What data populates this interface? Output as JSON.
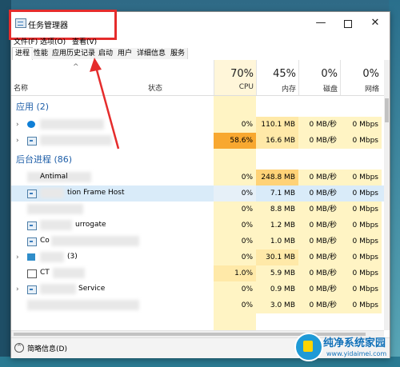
{
  "window": {
    "title": "任务管理器"
  },
  "menu": {
    "file": "文件(F)",
    "options": "选项(O)",
    "view": "查看(V)"
  },
  "tabs": [
    "进程",
    "性能",
    "应用历史记录",
    "启动",
    "用户",
    "详细信息",
    "服务"
  ],
  "header": {
    "name": "名称",
    "status": "状态",
    "cpu": {
      "pct": "70%",
      "label": "CPU"
    },
    "memory": {
      "pct": "45%",
      "label": "内存"
    },
    "disk": {
      "pct": "0%",
      "label": "磁盘"
    },
    "network": {
      "pct": "0%",
      "label": "网络"
    }
  },
  "groups": {
    "apps": "应用 (2)",
    "background": "后台进程 (86)"
  },
  "rows": [
    {
      "name": "",
      "cpu": "0%",
      "mem": "110.1 MB",
      "disk": "0 MB/秒",
      "net": "0 Mbps",
      "icon": "edge-icon"
    },
    {
      "name": "",
      "cpu": "58.6%",
      "mem": "16.6 MB",
      "disk": "0 MB/秒",
      "net": "0 Mbps",
      "icon": "task-manager-icon"
    },
    {
      "name": "Antimal",
      "cpu": "0%",
      "mem": "248.8 MB",
      "disk": "0 MB/秒",
      "net": "0 Mbps",
      "icon": ""
    },
    {
      "name": "tion Frame Host",
      "cpu": "0%",
      "mem": "7.1 MB",
      "disk": "0 MB/秒",
      "net": "0 Mbps",
      "icon": "app-icon"
    },
    {
      "name": "",
      "cpu": "0%",
      "mem": "8.8 MB",
      "disk": "0 MB/秒",
      "net": "0 Mbps",
      "icon": ""
    },
    {
      "name": "urrogate",
      "cpu": "0%",
      "mem": "1.2 MB",
      "disk": "0 MB/秒",
      "net": "0 Mbps",
      "icon": "app-icon"
    },
    {
      "name": "Co",
      "cpu": "0%",
      "mem": "1.0 MB",
      "disk": "0 MB/秒",
      "net": "0 Mbps",
      "icon": "app-icon"
    },
    {
      "name": "(3)",
      "cpu": "0%",
      "mem": "30.1 MB",
      "disk": "0 MB/秒",
      "net": "0 Mbps",
      "icon": "folder-icon"
    },
    {
      "name": "CT",
      "cpu": "1.0%",
      "mem": "5.9 MB",
      "disk": "0 MB/秒",
      "net": "0 Mbps",
      "icon": "ct-icon"
    },
    {
      "name": "Service",
      "cpu": "0%",
      "mem": "0.9 MB",
      "disk": "0 MB/秒",
      "net": "0 Mbps",
      "icon": "app-icon"
    },
    {
      "name": "",
      "cpu": "0%",
      "mem": "3.0 MB",
      "disk": "0 MB/秒",
      "net": "0 Mbps",
      "icon": ""
    }
  ],
  "footer": {
    "fewer_details": "简略信息(D)"
  },
  "watermark": {
    "title": "纯净系统家园",
    "url": "www.yidaimei.com"
  }
}
